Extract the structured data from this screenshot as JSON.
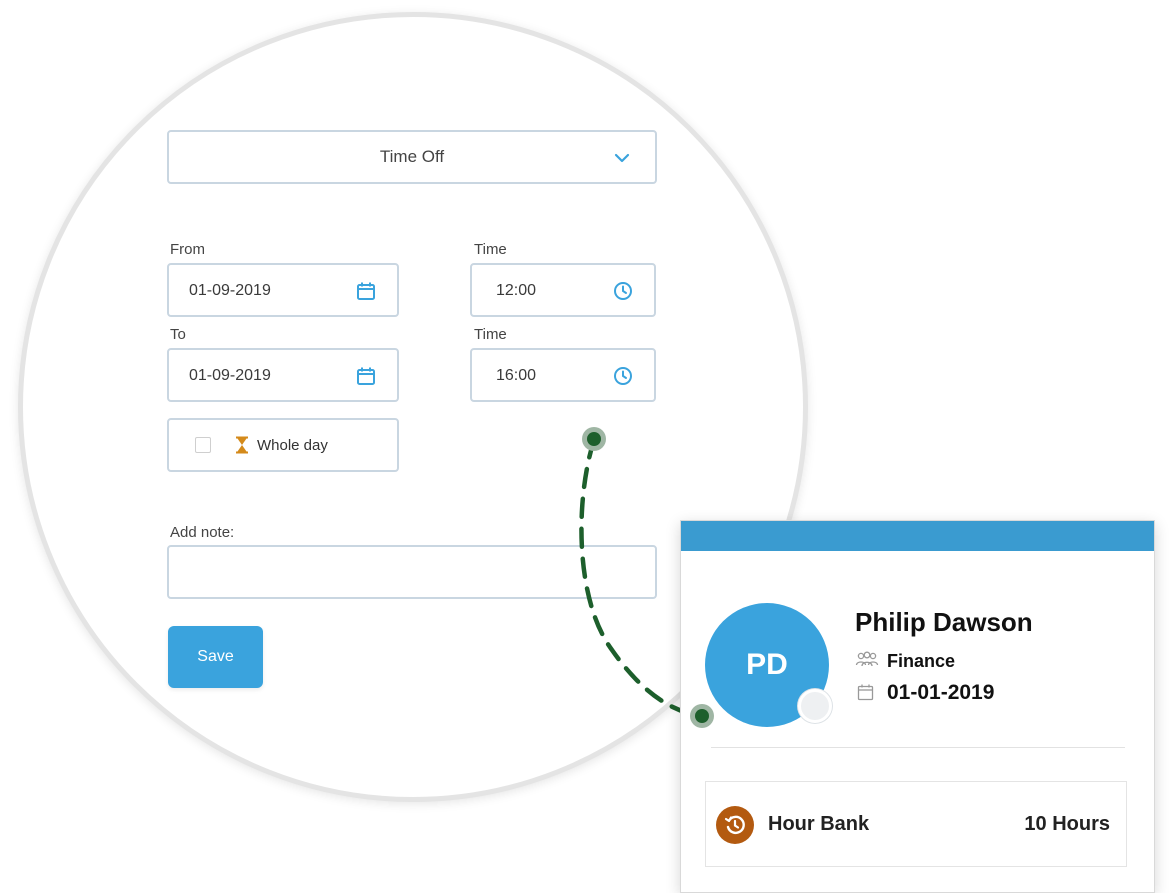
{
  "form": {
    "type_select": {
      "value": "Time Off"
    },
    "from": {
      "label": "From",
      "date": "01-09-2019",
      "time_label": "Time",
      "time": "12:00"
    },
    "to": {
      "label": "To",
      "date": "01-09-2019",
      "time_label": "Time",
      "time": "16:00"
    },
    "whole_day": {
      "label": "Whole day",
      "checked": false
    },
    "note": {
      "label": "Add note:",
      "value": ""
    },
    "save_label": "Save"
  },
  "profile": {
    "initials": "PD",
    "name": "Philip Dawson",
    "department": "Finance",
    "start_date": "01-01-2019",
    "hour_bank": {
      "label": "Hour Bank",
      "value": "10 Hours"
    }
  },
  "colors": {
    "accent": "#3aa3dd",
    "card_header": "#3a9bd0",
    "connector": "#1d5f2c",
    "hour_bank_icon": "#b35a10",
    "hourglass": "#d48a1a"
  },
  "icons": {
    "select": "chevron-down-icon",
    "date": "calendar-icon",
    "time": "clock-icon",
    "whole_day": "hourglass-icon",
    "department": "people-icon",
    "start_date": "calendar-icon",
    "hour_bank": "history-icon"
  }
}
